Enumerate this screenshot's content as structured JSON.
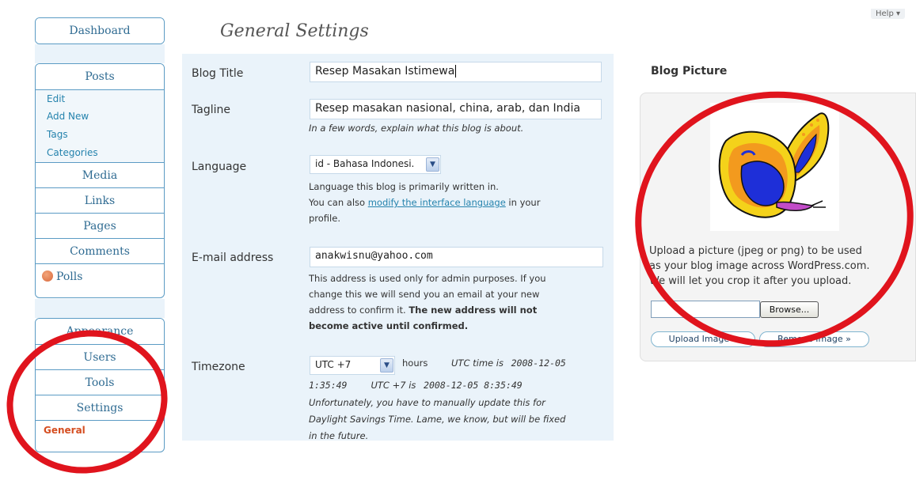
{
  "help": "Help",
  "page_title": "General Settings",
  "sidebar": {
    "dashboard": "Dashboard",
    "posts": "Posts",
    "posts_sub": [
      "Edit",
      "Add New",
      "Tags",
      "Categories"
    ],
    "media": "Media",
    "links": "Links",
    "pages": "Pages",
    "comments": "Comments",
    "polls": "Polls",
    "appearance": "Appearance",
    "users": "Users",
    "tools": "Tools",
    "settings": "Settings",
    "settings_current": "General"
  },
  "form": {
    "blog_title_label": "Blog Title",
    "blog_title_value": "Resep Masakan Istimewa",
    "tagline_label": "Tagline",
    "tagline_value": "Resep masakan nasional, china, arab, dan India",
    "tagline_desc": "In a few words, explain what this blog is about.",
    "language_label": "Language",
    "language_value": "id - Bahasa Indonesi.",
    "language_desc1": "Language this blog is primarily written in.",
    "language_desc2_pre": "You can also ",
    "language_desc2_link": "modify the interface language",
    "language_desc2_post": " in your",
    "language_desc3": "profile.",
    "email_label": "E-mail address",
    "email_value": "anakwisnu@yahoo.com",
    "email_desc1": "This address is used only for admin purposes. If you",
    "email_desc2": "change this we will send you an email at your new",
    "email_desc3_pre": "address to confirm it. ",
    "email_desc3_bold": "The new address will not",
    "email_desc4_bold": "become active until confirmed.",
    "timezone_label": "Timezone",
    "timezone_value": "UTC +7",
    "timezone_hours": "hours",
    "utc_time_label": "UTC time is",
    "utc_time_date": "2008-12-05",
    "utc_time_time": "1:35:49",
    "local_label": "UTC +7 is",
    "local_time": "2008-12-05 8:35:49",
    "tz_desc1": "Unfortunately, you have to manually update this for",
    "tz_desc2": "Daylight Savings Time. Lame, we know, but will be fixed",
    "tz_desc3": "in the future."
  },
  "blog_picture": {
    "title": "Blog Picture",
    "desc1": "Upload a picture (jpeg or png) to be used",
    "desc2": "as your blog image across WordPress.com.",
    "desc3": "We will let you crop it after you upload.",
    "browse": "Browse...",
    "upload": "Upload Image »",
    "remove": "Remove Image »"
  },
  "icons": {
    "dropdown": "chevron-down-icon",
    "polls": "polls-icon",
    "butterfly": "butterfly-image"
  },
  "colors": {
    "annotation_ring": "#e0141d",
    "nav_current": "#d54e21",
    "panel_bg": "#eaf3fa",
    "link": "#2583ad"
  }
}
